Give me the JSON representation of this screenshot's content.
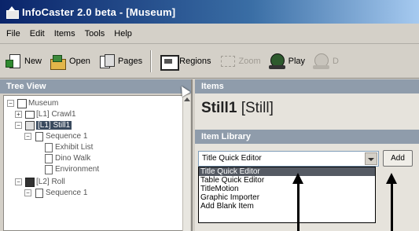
{
  "window": {
    "title": "InfoCaster 2.0 beta - [Museum]"
  },
  "menu": [
    "File",
    "Edit",
    "Items",
    "Tools",
    "Help"
  ],
  "toolbar": {
    "buttons": [
      {
        "label": "New",
        "icon": "new-icon",
        "enabled": true
      },
      {
        "label": "Open",
        "icon": "open-icon",
        "enabled": true
      },
      {
        "label": "Pages",
        "icon": "pages-icon",
        "enabled": true
      },
      {
        "label": "Regions",
        "icon": "regions-icon",
        "enabled": true
      },
      {
        "label": "Zoom",
        "icon": "zoom-icon",
        "enabled": false
      },
      {
        "label": "Play",
        "icon": "play-icon",
        "enabled": true
      },
      {
        "label": "D",
        "icon": "stop-icon",
        "enabled": false
      }
    ]
  },
  "tree": {
    "header": "Tree View",
    "nodes": [
      {
        "label": "Museum",
        "icon": "project",
        "expander": "−"
      },
      {
        "label": "[L1] Crawl1",
        "icon": "crawl",
        "expander": "+"
      },
      {
        "label": "[L1] Still1",
        "icon": "still",
        "expander": "−",
        "selected": true
      },
      {
        "label": "Sequence 1",
        "icon": "seq",
        "expander": "−"
      },
      {
        "label": "Exhibit List",
        "icon": "item"
      },
      {
        "label": "Dino Walk",
        "icon": "item"
      },
      {
        "label": "Environment",
        "icon": "item"
      },
      {
        "label": "[L2] Roll",
        "icon": "roll",
        "expander": "−"
      },
      {
        "label": "Sequence 1",
        "icon": "seq",
        "expander": "−"
      }
    ]
  },
  "items": {
    "header": "Items",
    "title_name": "Still1",
    "title_type": "[Still]"
  },
  "library": {
    "header": "Item Library",
    "selected": "Title Quick Editor",
    "add_label": "Add",
    "options": [
      "Title Quick Editor",
      "Table Quick Editor",
      "TitleMotion",
      "Graphic Importer",
      "Add Blank Item"
    ],
    "highlighted_index": 0
  }
}
